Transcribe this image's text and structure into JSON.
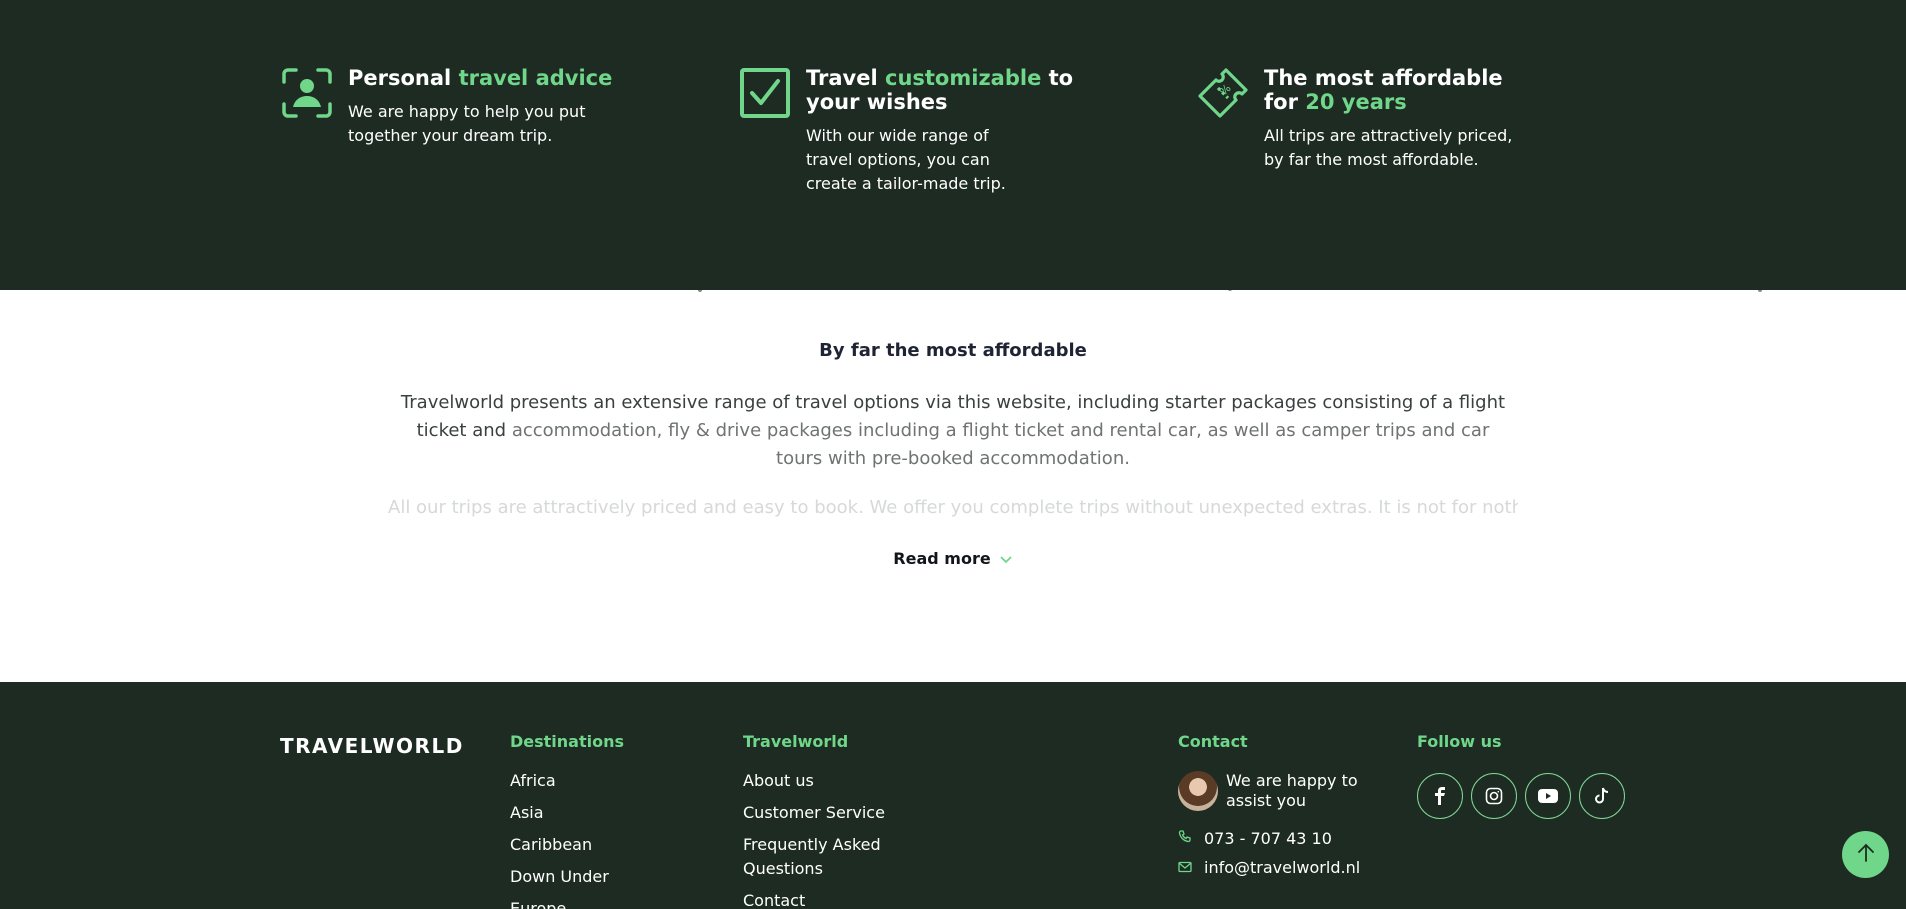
{
  "usps": [
    {
      "icon": "user-focus-icon",
      "title_plain": "Personal ",
      "title_highlight": "travel advice",
      "title_rest": "",
      "text": "We are happy to help you put together your dream trip."
    },
    {
      "icon": "checkbox-icon",
      "title_plain": "Travel ",
      "title_highlight": "customizable",
      "title_rest": " to your wishes",
      "text": "With our wide range of travel options, you can create a tailor-made trip."
    },
    {
      "icon": "ticket-icon",
      "title_plain": "The most affordable for ",
      "title_highlight": "20 years",
      "title_rest": "",
      "text": "All trips are attractively priced, by far the most affordable."
    }
  ],
  "intro": {
    "heading": "By far the most affordable",
    "p1_line1": "Travelworld presents an extensive range of travel options via this website, including starter packages consisting of a flight ticket and",
    "p1_rest": "accommodation, fly & drive packages including a flight ticket and rental car, as well as camper trips and car tours with pre-booked accommodation.",
    "p2": "All our trips are attractively priced and easy to book. We offer you complete trips without unexpected extras. It is not for nothing that",
    "read_more": "Read more"
  },
  "footer": {
    "logo": "TRAVELWORLD",
    "destinations": {
      "heading": "Destinations",
      "items": [
        "Africa",
        "Asia",
        "Caribbean",
        "Down Under",
        "Europe"
      ]
    },
    "travelworld": {
      "heading": "Travelworld",
      "items": [
        "About us",
        "Customer Service",
        "Frequently Asked Questions",
        "Contact"
      ]
    },
    "contact": {
      "heading": "Contact",
      "assist": "We are happy to assist you",
      "phone": "073 - 707 43 10",
      "email": "info@travelworld.nl"
    },
    "follow": {
      "heading": "Follow us",
      "icons": [
        "facebook-icon",
        "instagram-icon",
        "youtube-icon",
        "tiktok-icon"
      ]
    }
  },
  "colors": {
    "dark_green": "#1e2b22",
    "accent_green": "#6fd68a"
  }
}
